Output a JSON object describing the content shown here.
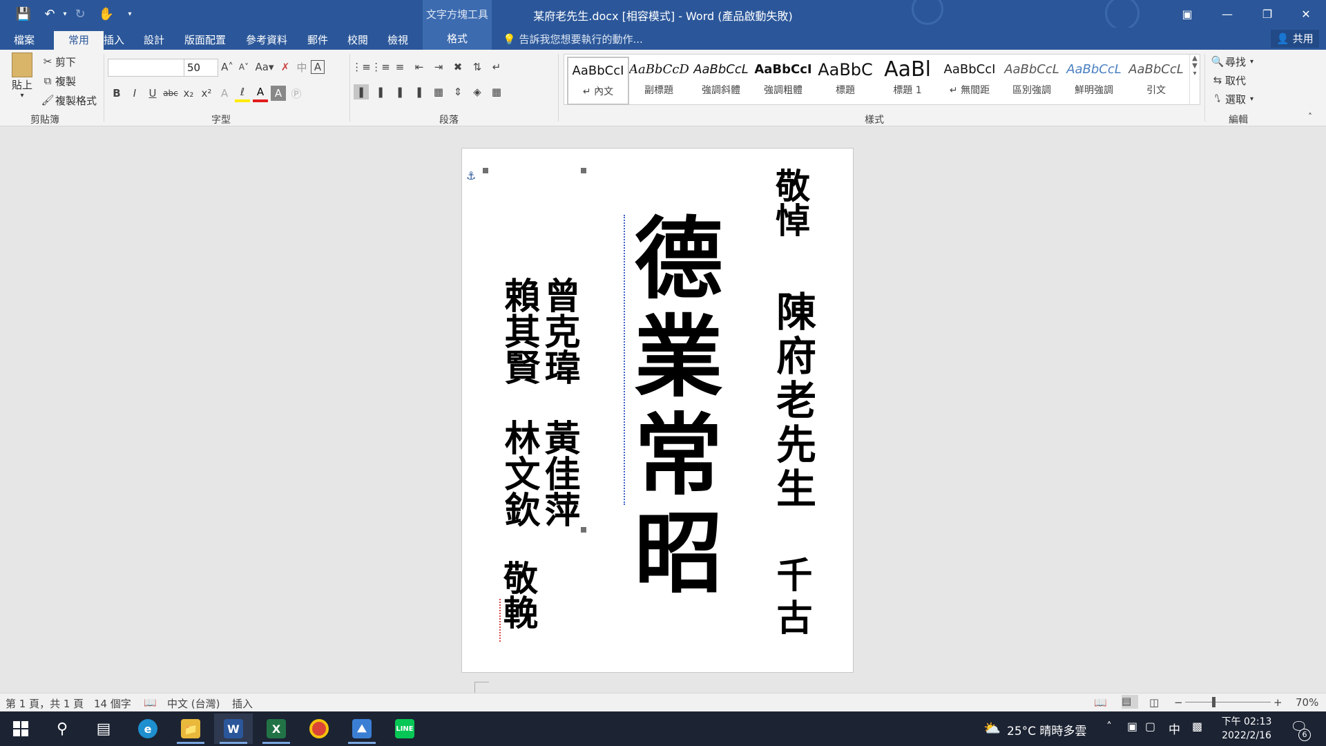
{
  "window": {
    "title": "某府老先生.docx [相容模式] - Word (產品啟動失敗)",
    "contextual_group": "文字方塊工具",
    "contextual_tab": "格式"
  },
  "tabs": [
    "檔案",
    "常用",
    "插入",
    "設計",
    "版面配置",
    "參考資料",
    "郵件",
    "校閱",
    "檢視"
  ],
  "tell_me": "告訴我您想要執行的動作...",
  "share": "共用",
  "clipboard": {
    "paste": "貼上",
    "cut": "剪下",
    "copy": "複製",
    "format_painter": "複製格式",
    "label": "剪貼簿"
  },
  "font": {
    "name_value": "",
    "size_value": "50",
    "label": "字型"
  },
  "paragraph": {
    "label": "段落"
  },
  "styles": {
    "label": "樣式",
    "items": [
      {
        "preview": "AaBbCcI",
        "name": "↵ 內文"
      },
      {
        "preview": "AaBbCcDı",
        "name": "副標題"
      },
      {
        "preview": "AaBbCcL",
        "name": "強調斜體"
      },
      {
        "preview": "AaBbCcI",
        "name": "強調粗體"
      },
      {
        "preview": "AaBbC",
        "name": "標題"
      },
      {
        "preview": "AaBl",
        "name": "標題 1"
      },
      {
        "preview": "AaBbCcI",
        "name": "↵ 無間距"
      },
      {
        "preview": "AaBbCcL",
        "name": "區別強調"
      },
      {
        "preview": "AaBbCcL",
        "name": "鮮明強調"
      },
      {
        "preview": "AaBbCcL",
        "name": "引文"
      }
    ]
  },
  "editing": {
    "find": "尋找",
    "replace": "取代",
    "select": "選取",
    "label": "編輯"
  },
  "document": {
    "right_top": "敬悼",
    "right_name": "陳府老先生",
    "right_bottom": "千古",
    "center": "德業常昭",
    "left_names": [
      "曾克瑋",
      "賴其賢",
      "黃佳萍",
      "林文欽"
    ],
    "left_bottom": "敬輓"
  },
  "status": {
    "page": "第 1 頁，共 1 頁",
    "words": "14 個字",
    "language": "中文 (台灣)",
    "mode": "插入",
    "zoom": "70%",
    "zoom_level": 0.7
  },
  "taskbar": {
    "weather": "25°C  晴時多雲",
    "ime": "中",
    "time": "下午 02:13",
    "date": "2022/2/16",
    "notifications": "6"
  },
  "colors": {
    "word_blue": "#2b579a",
    "ribbon_bg": "#f3f3f3",
    "taskbar_bg": "#1c2333"
  }
}
